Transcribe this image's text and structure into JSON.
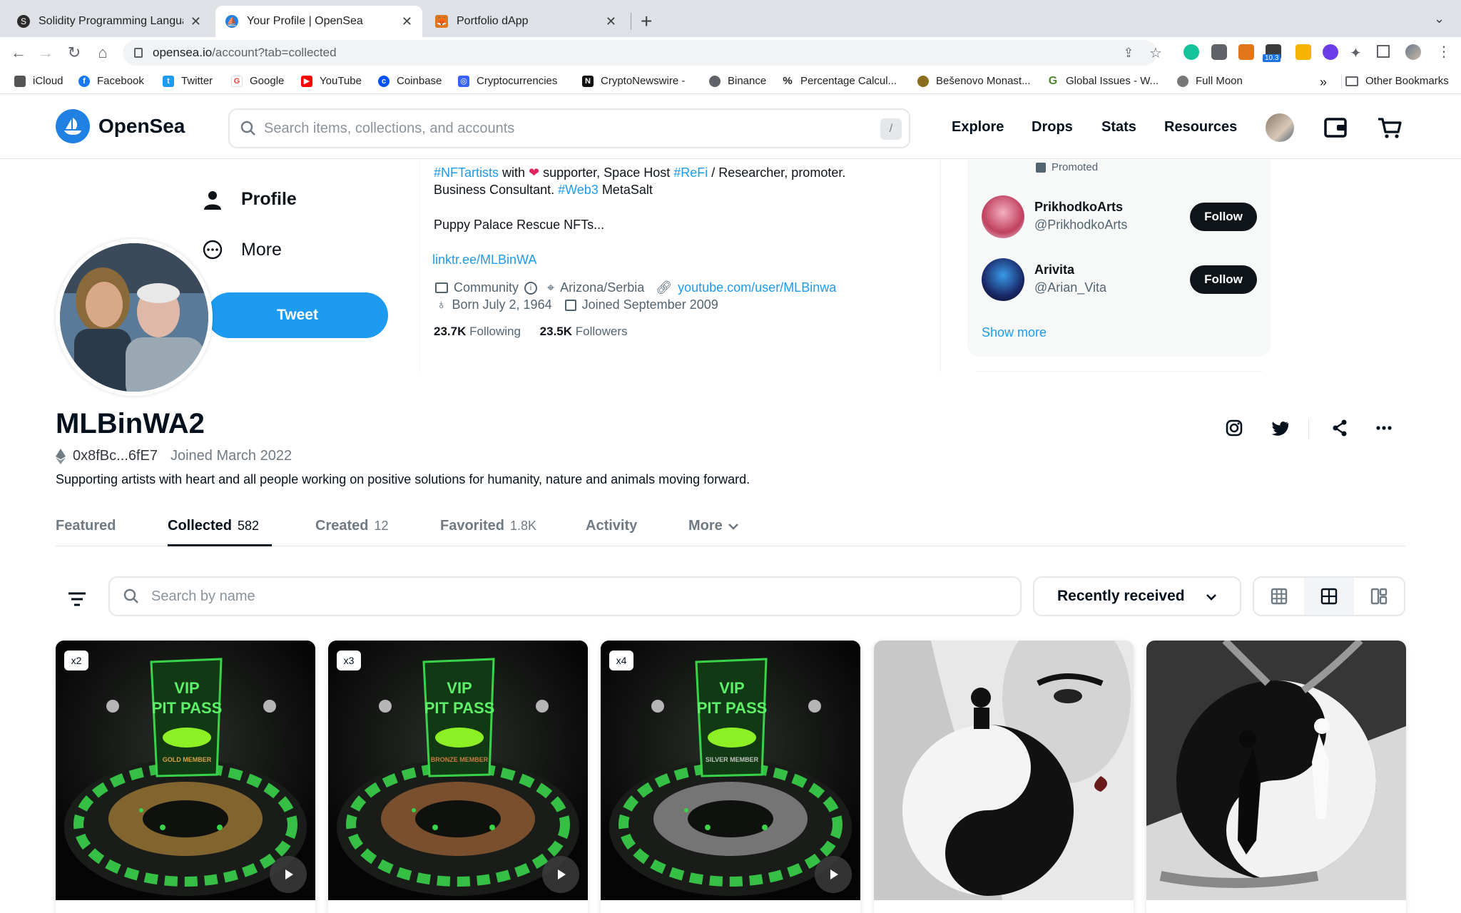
{
  "browser": {
    "tabs": [
      {
        "title": "Solidity Programming Languag",
        "active": false
      },
      {
        "title": "Your Profile | OpenSea",
        "active": true
      },
      {
        "title": "Portfolio dApp",
        "active": false
      }
    ],
    "new_tab": "+",
    "url_main": "opensea.io",
    "url_rest": "/account?tab=collected",
    "extension_badge": "10.3",
    "bookmarks": [
      {
        "label": "iCloud",
        "icon": "apple-icon",
        "color": "#555555"
      },
      {
        "label": "Facebook",
        "icon": "facebook-icon",
        "color": "#1877f2"
      },
      {
        "label": "Twitter",
        "icon": "twitter-icon",
        "color": "#1d9bf0"
      },
      {
        "label": "Google",
        "icon": "google-icon",
        "color": "#ea4335"
      },
      {
        "label": "YouTube",
        "icon": "youtube-icon",
        "color": "#ff0000"
      },
      {
        "label": "Coinbase",
        "icon": "coinbase-icon",
        "color": "#0052ff"
      },
      {
        "label": "Cryptocurrencies",
        "icon": "crypto-icon",
        "color": "#3861fb"
      },
      {
        "label": "CryptoNewswire -",
        "icon": "newswire-icon",
        "color": "#111111"
      },
      {
        "label": "Binance",
        "icon": "globe-icon",
        "color": "#5f6368"
      },
      {
        "label": "Percentage Calcul...",
        "icon": "percent-icon",
        "color": "#202124"
      },
      {
        "label": "Bešenovo Monast...",
        "icon": "leaf-icon",
        "color": "#8a6d1f"
      },
      {
        "label": "Global Issues - W...",
        "icon": "g-icon",
        "color": "#4a8a2a"
      },
      {
        "label": "Full Moon",
        "icon": "moon-icon",
        "color": "#777777"
      }
    ],
    "overflow": "»",
    "other_bookmarks": "Other Bookmarks"
  },
  "opensea": {
    "brand": "OpenSea",
    "search_placeholder": "Search items, collections, and accounts",
    "search_shortcut": "/",
    "nav": [
      "Explore",
      "Drops",
      "Stats",
      "Resources"
    ]
  },
  "banner": {
    "menu": [
      "Profile",
      "More"
    ],
    "tweet_button": "Tweet",
    "bio_line1": [
      {
        "t": "#NFTartists",
        "link": true
      },
      {
        "t": " with ",
        "link": false
      },
      {
        "t": " supporter, Space Host ",
        "link": false
      },
      {
        "t": "#ReFi",
        "link": true
      },
      {
        "t": " / Researcher, promoter.",
        "link": false
      }
    ],
    "bio_line2_a": "Business Consultant. ",
    "bio_line2_link": "#Web3",
    "bio_line2_b": " MetaSalt",
    "bio_line3": "Puppy Palace Rescue NFTs...",
    "link": "linktr.ee/MLBinWA",
    "category": "Community",
    "location": "Arizona/Serbia",
    "website": "youtube.com/user/MLBinwa",
    "born": "Born July 2, 1964",
    "joined": "Joined September 2009",
    "following_count": "23.7K",
    "following_label": "Following",
    "followers_count": "23.5K",
    "followers_label": "Followers",
    "promoted": "Promoted",
    "who_to_follow": [
      {
        "name": "PrikhodkoArts",
        "handle": "@PrikhodkoArts",
        "button": "Follow"
      },
      {
        "name": "Arivita",
        "handle": "@Arian_Vita",
        "button": "Follow"
      }
    ],
    "show_more": "Show more"
  },
  "profile": {
    "name": "MLBinWA2",
    "address": "0x8fBc...6fE7",
    "joined": "Joined March 2022",
    "bio": "Supporting artists with heart and all people working on positive solutions for humanity, nature and animals moving forward."
  },
  "tabs": [
    {
      "label": "Featured",
      "count": ""
    },
    {
      "label": "Collected",
      "count": "582"
    },
    {
      "label": "Created",
      "count": "12"
    },
    {
      "label": "Favorited",
      "count": "1.8K"
    },
    {
      "label": "Activity",
      "count": ""
    },
    {
      "label": "More",
      "count": ""
    }
  ],
  "active_tab": "Collected",
  "filters": {
    "search_placeholder": "Search by name",
    "sort": "Recently received"
  },
  "items": [
    {
      "qty": "x2",
      "type": "vip-pass",
      "member": "GOLD MEMBER",
      "video": true
    },
    {
      "qty": "x3",
      "type": "vip-pass",
      "member": "BRONZE MEMBER",
      "video": true
    },
    {
      "qty": "x4",
      "type": "vip-pass",
      "member": "SILVER MEMBER",
      "video": true
    },
    {
      "qty": "",
      "type": "yin-yang-woman",
      "video": false
    },
    {
      "qty": "",
      "type": "yin-yang-figures",
      "video": false
    }
  ],
  "vip_pass_text": [
    "VIP",
    "PIT PASS"
  ]
}
